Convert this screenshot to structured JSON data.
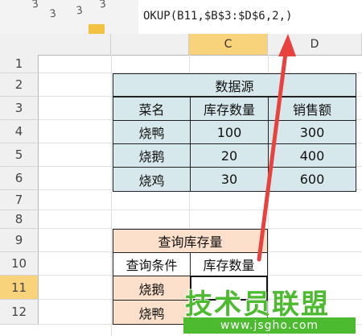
{
  "formula_bar": {
    "text": "OKUP(B11,$B$3:$D$6,2,)"
  },
  "toolbar": {
    "glyphs": [
      "3",
      "3",
      "3",
      "3"
    ]
  },
  "columns": {
    "c": "C",
    "d": "D"
  },
  "rows": [
    "1",
    "2",
    "3",
    "4",
    "5",
    "6",
    "7",
    "8",
    "9",
    "10",
    "11",
    "12"
  ],
  "data_source": {
    "title": "数据源",
    "headers": [
      "菜名",
      "库存数量",
      "销售额"
    ],
    "rows": [
      [
        "烧鸭",
        "100",
        "300"
      ],
      [
        "烧鹅",
        "20",
        "400"
      ],
      [
        "烧鸡",
        "30",
        "600"
      ]
    ]
  },
  "query": {
    "title": "查询库存量",
    "header_condition": "查询条件",
    "header_qty": "库存数量",
    "rows": [
      {
        "name": "烧鹅",
        "value": ""
      },
      {
        "name": "烧鸭",
        "value": ""
      }
    ]
  },
  "watermark": {
    "main": "技术员联盟",
    "url": "www.jsgho.com"
  },
  "colors": {
    "data_fill": "#d7e8ec",
    "query_fill": "#fce0cc",
    "arrow": "#e8423f",
    "watermark": "#4cbb2f",
    "selected_header": "#f9d37b"
  }
}
